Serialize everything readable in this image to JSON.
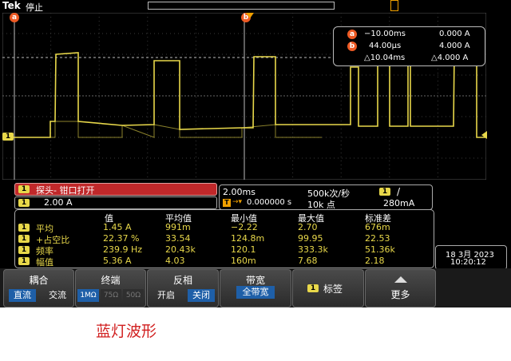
{
  "topbar": {
    "brand": "Tek",
    "acq_state": "停止"
  },
  "markers": {
    "a": "a",
    "b": "b"
  },
  "channel_label": "1",
  "cursor": {
    "a_time": "−10.00ms",
    "a_value": "0.000 A",
    "b_time": "44.00µs",
    "b_value": "4.000 A",
    "delta_time": "△10.04ms",
    "delta_value": "△4.000 A"
  },
  "channel": {
    "probe_message": "探头- 钳口打开",
    "scale": "2.00 A"
  },
  "horizontal": {
    "timebase": "2.00ms",
    "sample_rate": "500k次/秒",
    "trigger_slope": "/",
    "trigger_position": "0.000000 s",
    "record_length": "10k 点",
    "trigger_level": "280mA"
  },
  "measurements": {
    "headers": [
      "值",
      "平均值",
      "最小值",
      "最大值",
      "标准差"
    ],
    "rows": [
      {
        "name": "平均",
        "value": "1.45 A",
        "mean": "991m",
        "min": "−2.22",
        "max": "2.70",
        "std": "676m"
      },
      {
        "name": "+占空比",
        "value": "22.37 %",
        "mean": "33.54",
        "min": "124.8m",
        "max": "99.95",
        "std": "22.53"
      },
      {
        "name": "频率",
        "value": "239.9 Hz",
        "mean": "20.43k",
        "min": "120.1",
        "max": "333.3k",
        "std": "51.36k"
      },
      {
        "name": "幅值",
        "value": "5.36 A",
        "mean": "4.03",
        "min": "160m",
        "max": "7.68",
        "std": "2.18"
      }
    ]
  },
  "datetime": {
    "date": "18 3月 2023",
    "time": "10:20:12"
  },
  "menu": {
    "coupling": {
      "title": "耦合",
      "opt1": "直流",
      "opt2": "交流"
    },
    "termination": {
      "title": "终端",
      "opt1": "1MΩ",
      "opt2": "75Ω",
      "opt3": "50Ω"
    },
    "invert": {
      "title": "反相",
      "opt1": "开启",
      "opt2": "关闭"
    },
    "bandwidth": {
      "title": "带宽",
      "opt1": "全带宽"
    },
    "label": {
      "title": "标签"
    },
    "more": {
      "title": "更多"
    }
  },
  "colors": {
    "ch1": "#e8d84a",
    "cursor_marker": "#ee5a24",
    "probe_warning": "#c0282a",
    "selected": "#1e5fa8"
  },
  "caption": "蓝灯波形"
}
